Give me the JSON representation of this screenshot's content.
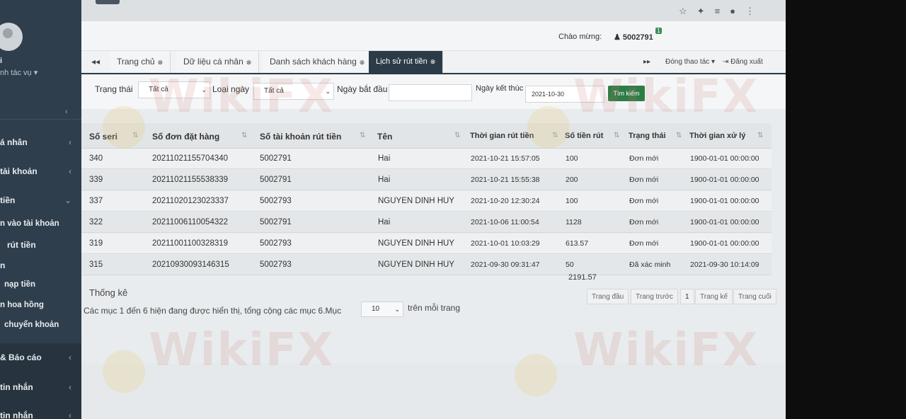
{
  "sidebar": {
    "user_name": "i",
    "actions": "nh tác vụ ▾",
    "collapse": "‹",
    "items": [
      {
        "label": "á nhân",
        "chevron": "‹"
      },
      {
        "label": "tài khoản",
        "chevron": "‹"
      },
      {
        "label": "tiền",
        "chevron": "⌄"
      },
      {
        "label": "n vào tài khoản",
        "chevron": ""
      },
      {
        "label": "rút tiền",
        "chevron": ""
      },
      {
        "label": "n",
        "chevron": ""
      },
      {
        "label": "nạp tiền",
        "chevron": ""
      },
      {
        "label": "n hoa hồng",
        "chevron": ""
      },
      {
        "label": "chuyển khoản",
        "chevron": ""
      },
      {
        "label": "& Báo cáo",
        "chevron": "‹"
      },
      {
        "label": "tin nhắn",
        "chevron": "‹"
      },
      {
        "label": "tin nhắn",
        "chevron": "‹"
      }
    ]
  },
  "header": {
    "welcome": "Chào mừng:",
    "user_id": "5002791",
    "badge": "1"
  },
  "tabs": [
    {
      "label": "Trang chủ"
    },
    {
      "label": "Dữ liệu cá nhân"
    },
    {
      "label": "Danh sách khách hàng"
    },
    {
      "label": "Lịch sử rút tiền"
    }
  ],
  "tab_actions": {
    "prev": "◂◂",
    "next": "▸▸",
    "close_ops": "Đóng thao tác ▾",
    "logout": "⇥ Đăng xuất"
  },
  "filters": {
    "status_label": "Trạng thái",
    "status_value": "Tất cả",
    "date_type_label": "Loại ngày",
    "date_type_value": "Tất cả",
    "start_label": "Ngày bắt đầu",
    "start_value": "",
    "end_label": "Ngày kết thúc",
    "end_value": "2021-10-30",
    "search_label": "Tìm kiếm"
  },
  "table": {
    "columns": [
      "Số seri",
      "Số đơn đặt hàng",
      "Số tài khoản rút tiền",
      "Tên",
      "Thời gian rút tiền",
      "Số tiền rút",
      "Trạng thái",
      "Thời gian xử lý"
    ],
    "rows": [
      [
        "340",
        "20211021155704340",
        "5002791",
        "Hai",
        "2021-10-21 15:57:05",
        "100",
        "Đơn mới",
        "1900-01-01 00:00:00"
      ],
      [
        "339",
        "20211021155538339",
        "5002791",
        "Hai",
        "2021-10-21 15:55:38",
        "200",
        "Đơn mới",
        "1900-01-01 00:00:00"
      ],
      [
        "337",
        "20211020123023337",
        "5002793",
        "NGUYEN DINH HUY",
        "2021-10-20 12:30:24",
        "100",
        "Đơn mới",
        "1900-01-01 00:00:00"
      ],
      [
        "322",
        "20211006110054322",
        "5002791",
        "Hai",
        "2021-10-06 11:00:54",
        "1128",
        "Đơn mới",
        "1900-01-01 00:00:00"
      ],
      [
        "319",
        "20211001100328319",
        "5002793",
        "NGUYEN DINH HUY",
        "2021-10-01 10:03:29",
        "613.57",
        "Đơn mới",
        "1900-01-01 00:00:00"
      ],
      [
        "315",
        "20210930093146315",
        "5002793",
        "NGUYEN DINH HUY",
        "2021-09-30 09:31:47",
        "50",
        "Đã xác minh",
        "2021-09-30 10:14:09"
      ]
    ],
    "total": "2191.57",
    "stats_label": "Thống kê"
  },
  "pagination": {
    "first": "Trang đầu",
    "prev": "Trang trước",
    "current": "1",
    "next": "Trang kế",
    "last": "Trang cuối"
  },
  "footer": {
    "summary": "Các mục 1 đến 6 hiện đang được hiển thị, tổng cộng các mục 6.Mục",
    "per_page_value": "10",
    "per_page_suffix": "trên mỗi trang"
  },
  "watermark": "WikiFX"
}
